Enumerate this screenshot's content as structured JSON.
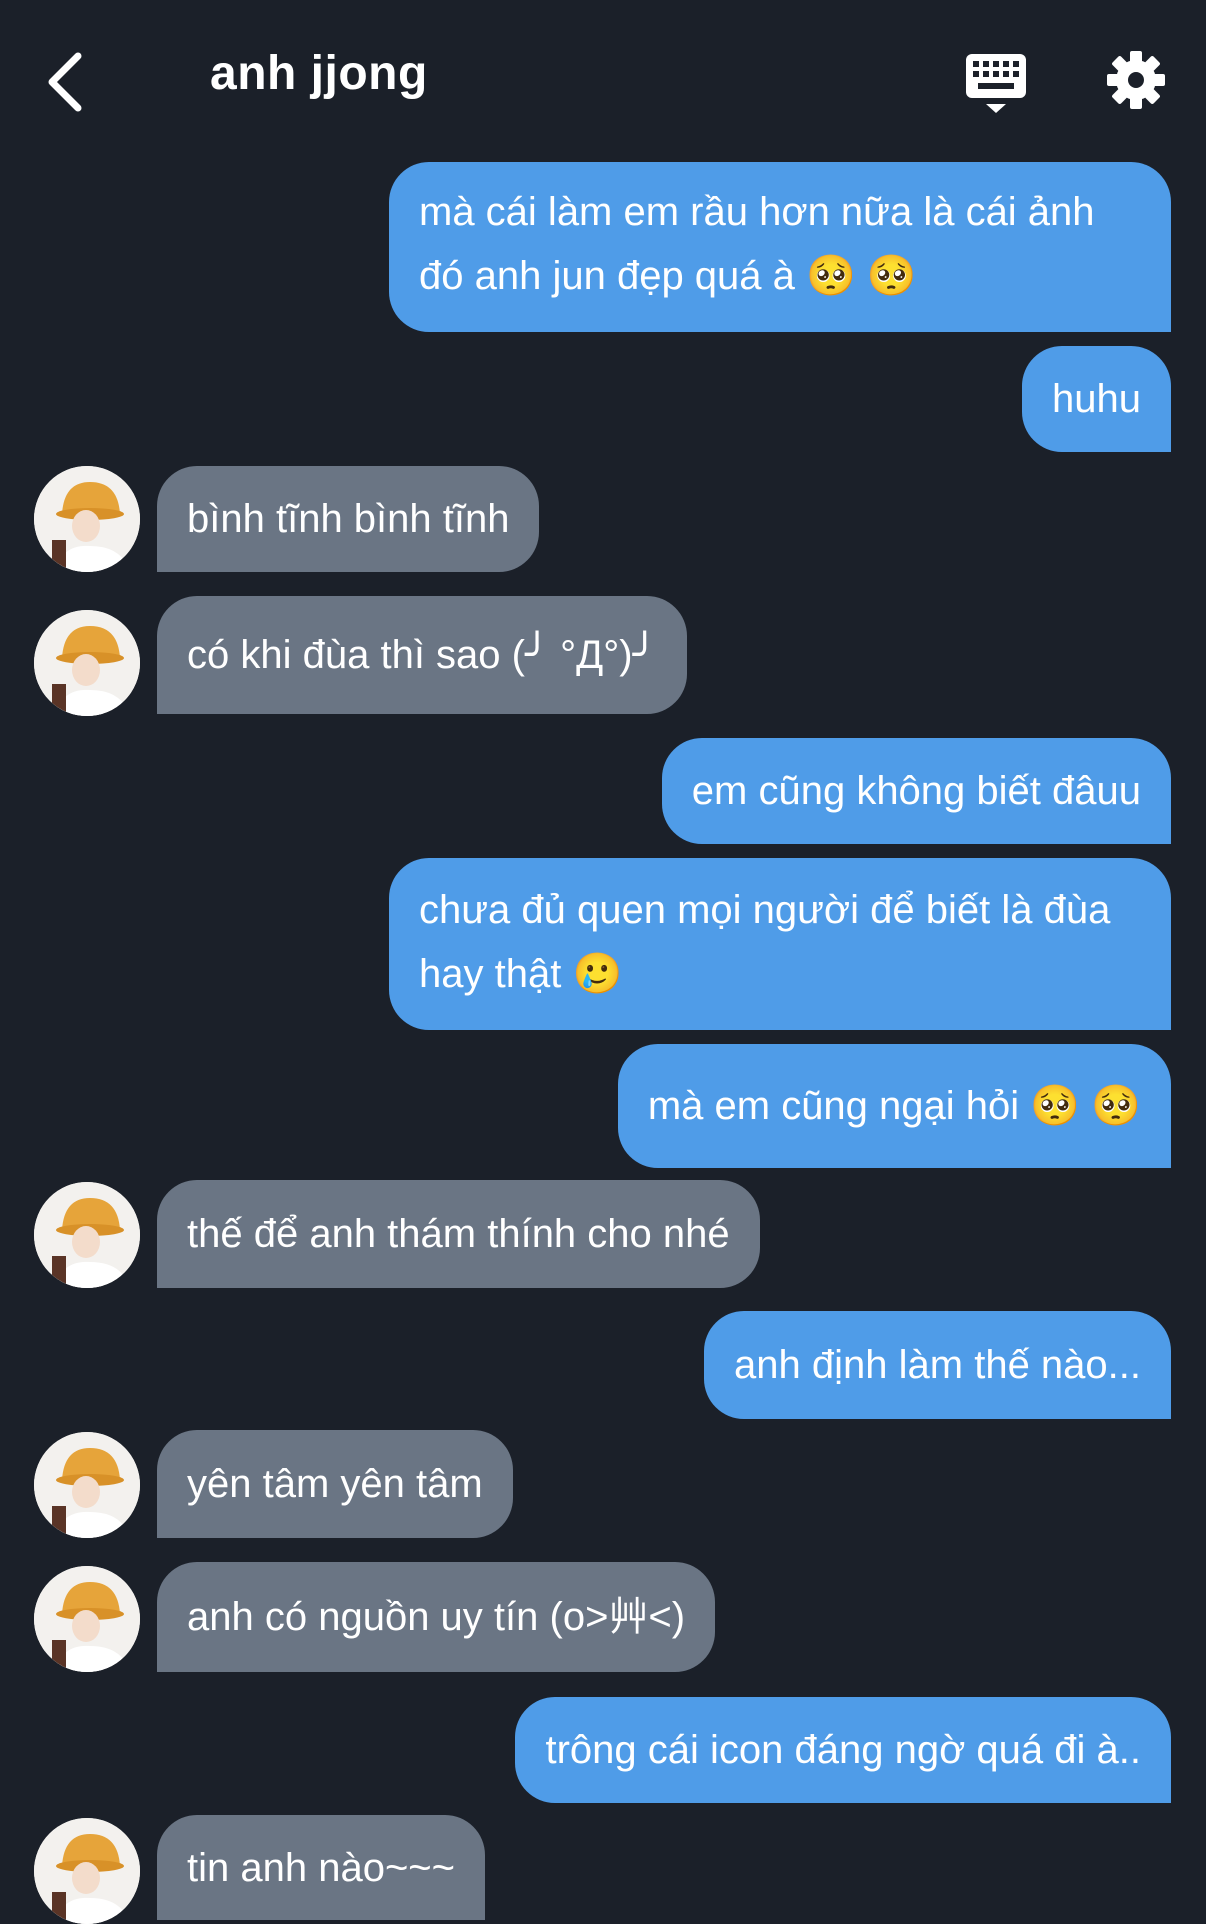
{
  "header": {
    "title": "anh jjong"
  },
  "colors": {
    "background": "#1b2029",
    "sent_bubble": "#4f9ce8",
    "received_bubble": "#6a7584"
  },
  "messages": [
    {
      "side": "sent",
      "text": "mà cái làm em rầu hơn nữa là cái ảnh đó anh jun đẹp quá à 🥺 🥺"
    },
    {
      "side": "sent",
      "text": "huhu"
    },
    {
      "side": "received",
      "text": "bình tĩnh bình tĩnh"
    },
    {
      "side": "received",
      "text": "có khi đùa thì sao (╯ °Д°)╯"
    },
    {
      "side": "sent",
      "text": "em cũng không biết đâuu"
    },
    {
      "side": "sent",
      "text": "chưa đủ quen mọi người để biết là đùa hay thật 🥲"
    },
    {
      "side": "sent",
      "text": "mà em cũng ngại hỏi 🥺 🥺"
    },
    {
      "side": "received",
      "text": "thế để anh thám thính cho nhé"
    },
    {
      "side": "sent",
      "text": "anh định làm thế nào..."
    },
    {
      "side": "received",
      "text": "yên tâm yên tâm"
    },
    {
      "side": "received",
      "text": "anh có nguồn uy tín (o>艸<)"
    },
    {
      "side": "sent",
      "text": "trông cái icon đáng ngờ quá đi à.."
    },
    {
      "side": "received",
      "text": "tin anh nào~~~"
    }
  ]
}
